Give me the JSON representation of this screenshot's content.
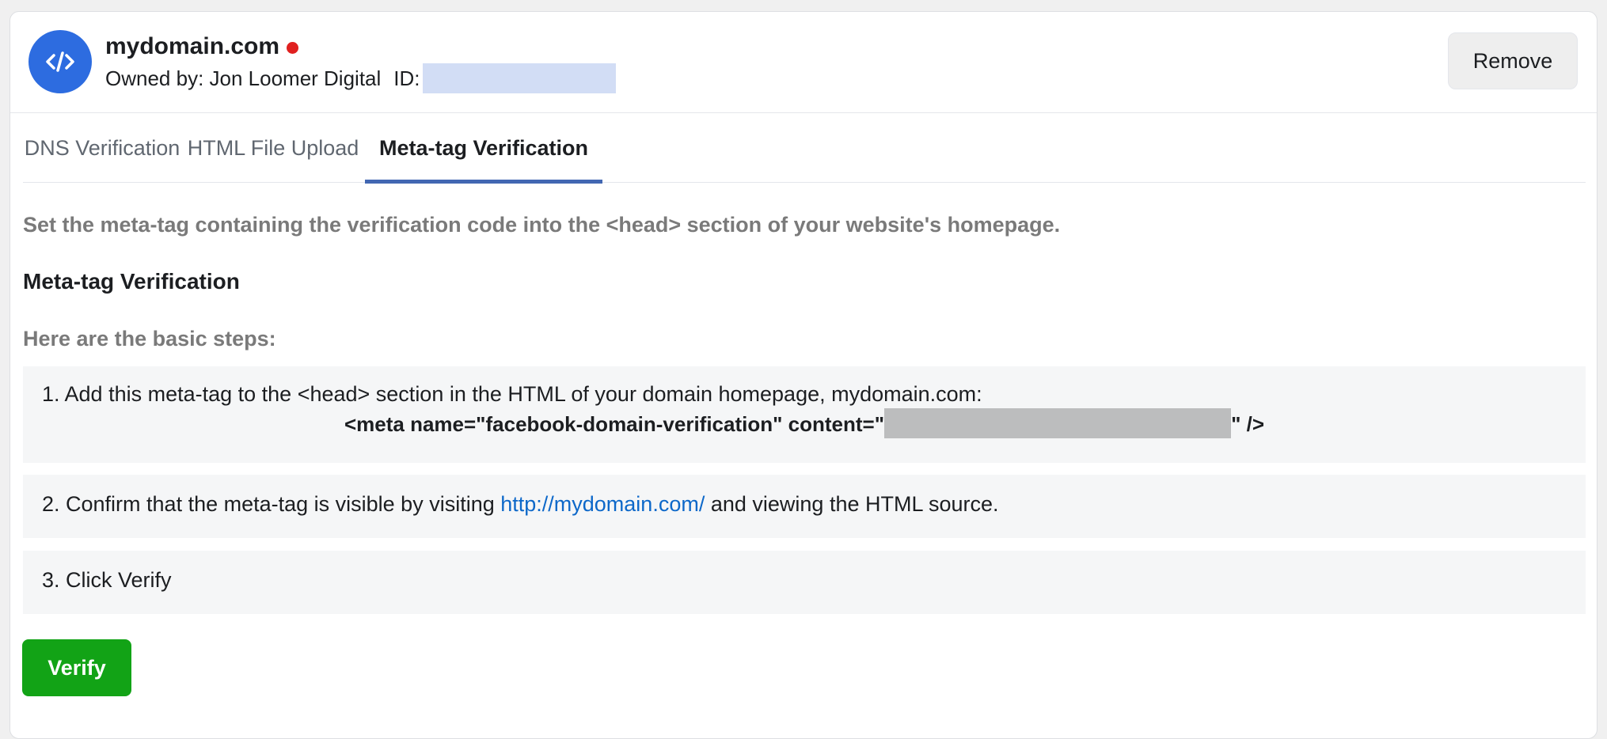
{
  "header": {
    "domain_name": "mydomain.com",
    "owner_text": "Owned by: Jon Loomer Digital",
    "id_label": "ID:",
    "remove_label": "Remove",
    "avatar_icon": "code-icon",
    "status_color": "#e0201f"
  },
  "tabs": [
    {
      "label": "DNS Verification",
      "active": false
    },
    {
      "label": "HTML File Upload",
      "active": false
    },
    {
      "label": "Meta-tag Verification",
      "active": true
    }
  ],
  "content": {
    "intro": "Set the meta-tag containing the verification code into the <head> section of your website's homepage.",
    "section_title": "Meta-tag Verification",
    "steps_heading": "Here are the basic steps:",
    "step1_text": "1. Add this meta-tag to the <head> section in the HTML of your domain homepage, mydomain.com:",
    "meta_code_prefix": "<meta name=\"facebook-domain-verification\" content=\"",
    "meta_code_suffix": "\" />",
    "step2_prefix": "2. Confirm that the meta-tag is visible by visiting ",
    "step2_link": "http://mydomain.com/",
    "step2_suffix": " and viewing the HTML source.",
    "step3_text": "3. Click Verify"
  },
  "actions": {
    "verify_label": "Verify"
  },
  "colors": {
    "accent": "#4267b2",
    "avatar": "#2d6ce0",
    "verify": "#12a316",
    "link": "#0d68c9"
  }
}
